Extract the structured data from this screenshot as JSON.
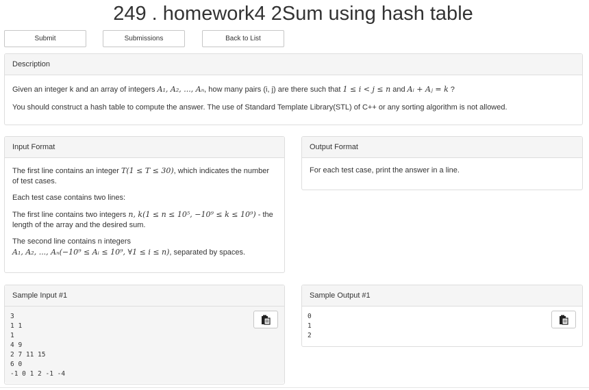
{
  "title": "249 . homework4 2Sum using hash table",
  "buttons": {
    "submit": "Submit",
    "submissions": "Submissions",
    "back": "Back to List"
  },
  "description": {
    "heading": "Description",
    "p1": {
      "prefix": "Given an integer k and an array of integers ",
      "array_math": "A₁, A₂, ..., Aₙ",
      "middle": ", how many pairs (i, j) are there such that ",
      "cond1": "1 ≤ i < j ≤ n",
      "and": " and ",
      "cond2": "Aᵢ + Aⱼ = k",
      "suffix": " ?"
    },
    "p2": "You should construct a hash table to compute the answer. The use of Standard Template Library(STL) of C++ or any sorting algorithm is not allowed."
  },
  "input_format": {
    "heading": "Input Format",
    "line1_prefix": "The first line contains an integer ",
    "line1_math": "T(1 ≤ T ≤ 30)",
    "line1_suffix": ", which indicates the number of test cases.",
    "line2": "Each test case contains two lines:",
    "line3_prefix": "The first line contains two integers ",
    "line3_math": "n, k(1 ≤ n ≤ 10⁵, −10⁹ ≤ k ≤ 10⁹)",
    "line3_suffix": " - the length of the array and the desired sum.",
    "line4_prefix": "The second line contains n integers",
    "line4_math": "A₁, A₂, ..., Aₙ(−10⁹ ≤ Aᵢ ≤ 10⁹, ∀1 ≤ i ≤ n)",
    "line4_suffix": ", separated by spaces."
  },
  "output_format": {
    "heading": "Output Format",
    "text": "For each test case, print the answer in a line."
  },
  "sample_input": {
    "heading": "Sample Input #1",
    "content": "3\n1 1\n1\n4 9\n2 7 11 15\n6 0\n-1 0 1 2 -1 -4"
  },
  "sample_output": {
    "heading": "Sample Output #1",
    "content": "0\n1\n2"
  },
  "icons": {
    "copy": "clipboard-icon"
  }
}
